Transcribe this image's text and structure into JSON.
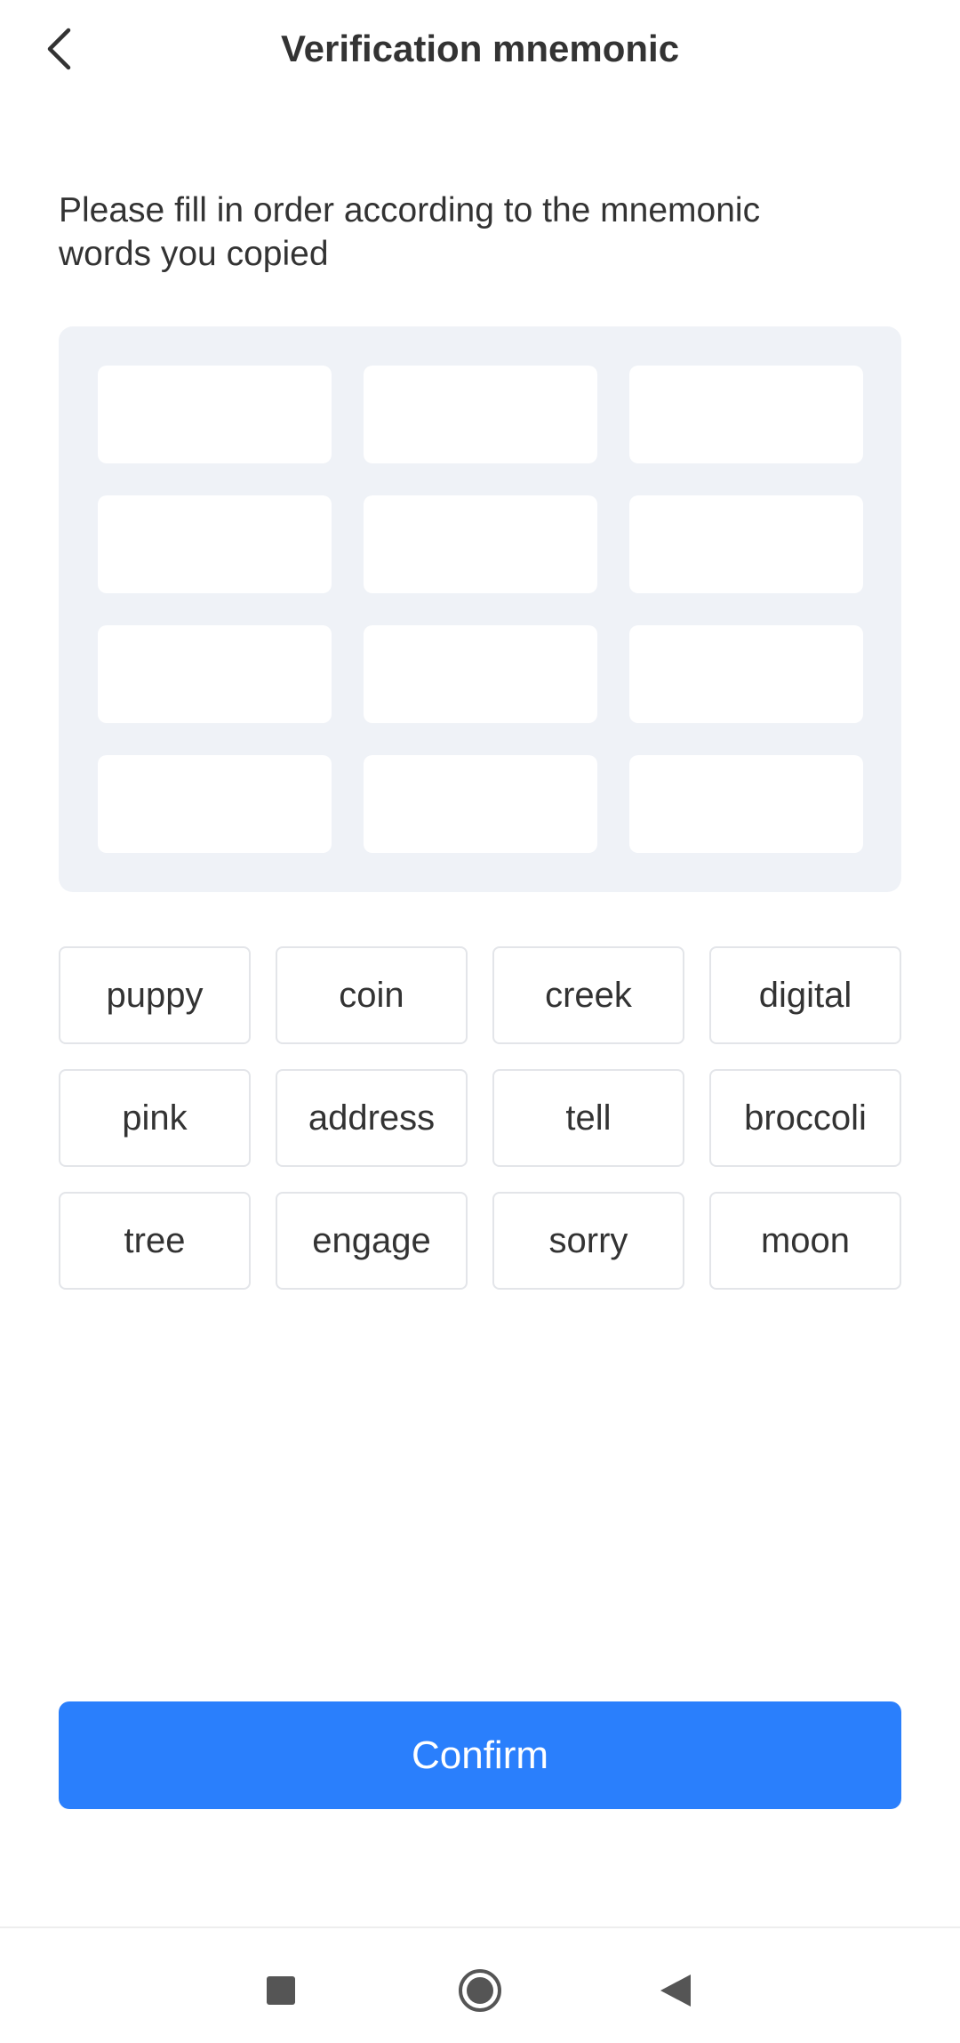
{
  "header": {
    "title": "Verification mnemonic",
    "back_icon": "chevron-left-icon"
  },
  "instruction": "Please fill in order according to the mnemonic words you copied",
  "slots": [
    "",
    "",
    "",
    "",
    "",
    "",
    "",
    "",
    "",
    "",
    "",
    ""
  ],
  "words": [
    "puppy",
    "coin",
    "creek",
    "digital",
    "pink",
    "address",
    "tell",
    "broccoli",
    "tree",
    "engage",
    "sorry",
    "moon"
  ],
  "confirm_label": "Confirm",
  "colors": {
    "accent": "#2a7ffc",
    "panel": "#eff2f7",
    "text": "#333333"
  },
  "nav": [
    "recents-square-icon",
    "home-circle-icon",
    "back-triangle-icon"
  ]
}
